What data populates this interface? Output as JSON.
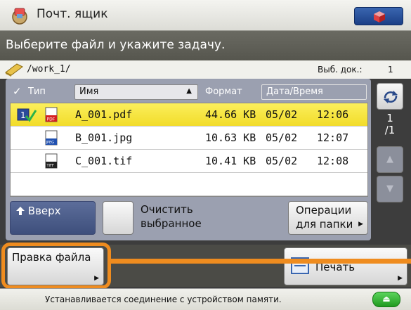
{
  "title": {
    "text": "Почт. ящик"
  },
  "instruction": "Выберите файл и укажите задачу.",
  "path": {
    "text": "/work_1/",
    "selected_label": "Выб. док.:",
    "selected_count": "1"
  },
  "list": {
    "header": {
      "check": "✓",
      "type": "Тип",
      "name": "Имя",
      "sort_indicator": "▲",
      "format": "Формат",
      "date": "Дата/Время"
    },
    "rows": [
      {
        "name": "A_001.pdf",
        "size": "44.66 KB",
        "date": "05/02",
        "time": "12:06",
        "type_icon": "pdf-icon",
        "checked": true
      },
      {
        "name": "B_001.jpg",
        "size": "10.63 KB",
        "date": "05/02",
        "time": "12:07",
        "type_icon": "jpeg-icon",
        "checked": false
      },
      {
        "name": "C_001.tif",
        "size": "10.41 KB",
        "date": "05/02",
        "time": "12:08",
        "type_icon": "tiff-icon",
        "checked": false
      }
    ]
  },
  "pager": {
    "current": "1",
    "total": "/1"
  },
  "buttons": {
    "up": "Вверх",
    "clear_line1": "Очистить",
    "clear_line2": "выбранное",
    "folder_line1": "Операции",
    "folder_line2": "для папки",
    "edit": "Правка файла",
    "print": "Печать",
    "arrow": "▶"
  },
  "status": {
    "text": "Устанавливается соединение с устройством памяти."
  },
  "colors": {
    "selected_row": "#f5e23a",
    "highlight": "#ef8c1f",
    "panel": "#9ba0b0"
  }
}
